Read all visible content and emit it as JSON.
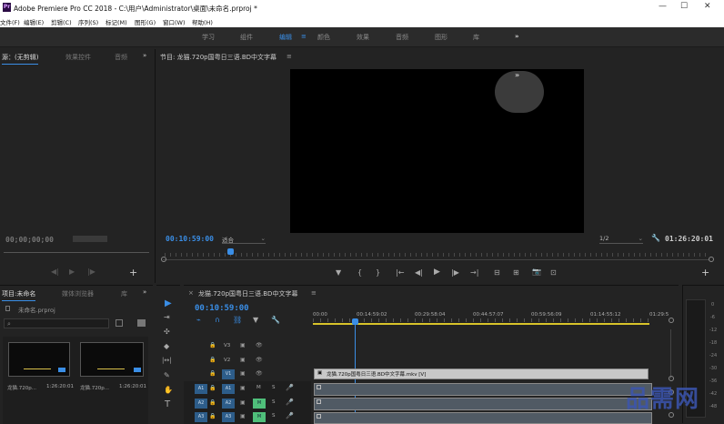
{
  "app": {
    "title": "Adobe Premiere Pro CC 2018 - C:\\用户\\Administrator\\桌面\\未命名.prproj *",
    "logo_text": "Pr"
  },
  "window_controls": {
    "minimize": "—",
    "maximize": "☐",
    "close": "✕"
  },
  "menu": [
    "文件(F)",
    "编辑(E)",
    "剪辑(C)",
    "序列(S)",
    "标记(M)",
    "图形(G)",
    "窗口(W)",
    "帮助(H)"
  ],
  "workspaces": {
    "items": [
      "学习",
      "组件",
      "编辑",
      "颜色",
      "效果",
      "音频",
      "图形",
      "库"
    ],
    "active": "编辑",
    "active_suffix": "≡",
    "more": "»"
  },
  "source_panel": {
    "tabs": [
      "源：(无剪辑)",
      "效果控件",
      "音频"
    ],
    "more": "»",
    "timecode": "00;00;00;00"
  },
  "program_monitor": {
    "title": "节目: 龙猫.720p国粤日三语.BD中文字幕",
    "menu": "≡",
    "timecode": "00:10:59:00",
    "fit": "适合",
    "resolution": "1/2",
    "duration": "01:26:20:01",
    "overlay_glyph": "»"
  },
  "transport": [
    "▼",
    "{",
    "}",
    "|←",
    "◀|",
    "▶",
    "|▶",
    "→|",
    "⊟",
    "⊞",
    "📷",
    "⊡"
  ],
  "project_panel": {
    "tabs": [
      "项目:未命名",
      "媒体浏览器",
      "库"
    ],
    "more": "»",
    "file": "未命名.prproj",
    "items": [
      {
        "name": "龙猫.720p...",
        "duration": "1:26:20:01"
      },
      {
        "name": "龙猫.720p...",
        "duration": "1:26:20:01"
      }
    ]
  },
  "tools": [
    "▶",
    "⇥",
    "✣",
    "◆",
    "|↔|",
    "✎",
    "✋",
    "T"
  ],
  "timeline": {
    "tab": "龙猫.720p国粤日三语.BD中文字幕",
    "close": "×",
    "menu": "≡",
    "timecode": "00:10:59:00",
    "ruler": [
      "00:00",
      "00:14:59:02",
      "00:29:58:04",
      "00:44:57:07",
      "00:59:56:09",
      "01:14:55:12",
      "01:29:5"
    ],
    "video_tracks": [
      "V3",
      "V2",
      "V1"
    ],
    "audio_tracks": [
      "A1",
      "A2",
      "A3"
    ],
    "clip_label": "龙猫.720p国粤日三语.BD中文字幕.mkv [V]",
    "m_label": "M",
    "s_label": "S"
  },
  "meter": {
    "scale": [
      "0",
      "-6",
      "-12",
      "-18",
      "-24",
      "-30",
      "-36",
      "-42",
      "-48"
    ]
  },
  "watermark": "品需网"
}
